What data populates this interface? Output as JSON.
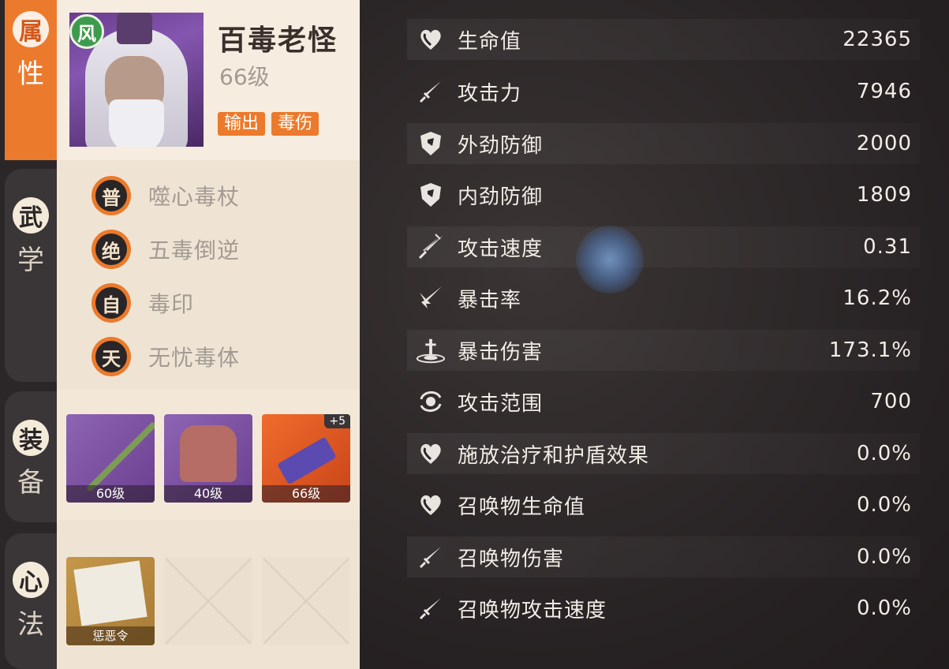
{
  "tabs": [
    {
      "char1": "属",
      "char2": "性",
      "active": true
    },
    {
      "char1": "武",
      "char2": "学",
      "active": false
    },
    {
      "char1": "装",
      "char2": "备",
      "active": false
    },
    {
      "char1": "心",
      "char2": "法",
      "active": false
    }
  ],
  "hero": {
    "element": "风",
    "name": "百毒老怪",
    "level": "66级",
    "tags": [
      "输出",
      "毒伤"
    ]
  },
  "skills": [
    {
      "type": "普",
      "name": "噬心毒杖"
    },
    {
      "type": "绝",
      "name": "五毒倒逆"
    },
    {
      "type": "自",
      "name": "毒印"
    },
    {
      "type": "天",
      "name": "无忧毒体"
    }
  ],
  "equipment": [
    {
      "level": "60级",
      "item": "spear"
    },
    {
      "level": "40级",
      "item": "robe"
    },
    {
      "level": "66级",
      "item": "comb",
      "plus": "+5"
    }
  ],
  "xinfa": {
    "scroll_name": "惩恶令"
  },
  "stats": [
    {
      "icon": "heart-icon",
      "label": "生命值",
      "value": "22365"
    },
    {
      "icon": "sword-icon",
      "label": "攻击力",
      "value": "7946"
    },
    {
      "icon": "shield-icon",
      "label": "外劲防御",
      "value": "2000"
    },
    {
      "icon": "shield-icon",
      "label": "内劲防御",
      "value": "1809"
    },
    {
      "icon": "crossed-swords-icon",
      "label": "攻击速度",
      "value": "0.31"
    },
    {
      "icon": "crit-icon",
      "label": "暴击率",
      "value": "16.2%"
    },
    {
      "icon": "crit-damage-icon",
      "label": "暴击伤害",
      "value": "173.1%"
    },
    {
      "icon": "range-icon",
      "label": "攻击范围",
      "value": "700"
    },
    {
      "icon": "heart-icon",
      "label": "施放治疗和护盾效果",
      "value": "0.0%"
    },
    {
      "icon": "heart-icon",
      "label": "召唤物生命值",
      "value": "0.0%"
    },
    {
      "icon": "sword-icon",
      "label": "召唤物伤害",
      "value": "0.0%"
    },
    {
      "icon": "sword-icon",
      "label": "召唤物攻击速度",
      "value": "0.0%"
    }
  ],
  "colors": {
    "accent": "#ec7a2c",
    "panel_light": "#efe4d4",
    "panel_dark": "#2a2526",
    "element_green": "#3e9b4d"
  }
}
